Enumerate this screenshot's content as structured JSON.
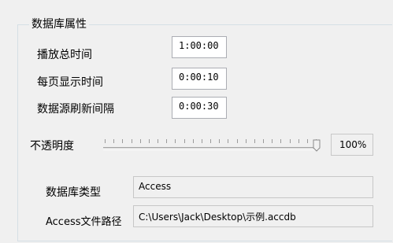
{
  "group": {
    "title": "数据库属性"
  },
  "fields": [
    {
      "label": "播放总时间",
      "value": "1:00:00"
    },
    {
      "label": "每页显示时间",
      "value": "0:00:10"
    },
    {
      "label": "数据源刷新间隔",
      "value": "0:00:30"
    }
  ],
  "opacity": {
    "label": "不透明度",
    "value_text": "100%",
    "level": 1.0
  },
  "db_type": {
    "label": "数据库类型",
    "value": "Access"
  },
  "access_path": {
    "label": "Access文件路径",
    "value": "C:\\Users\\Jack\\Desktop\\示例.accdb"
  },
  "colors": {
    "window_bg": "#f0f0f0",
    "border": "#abadb3",
    "group_border": "#d5dfe5"
  }
}
